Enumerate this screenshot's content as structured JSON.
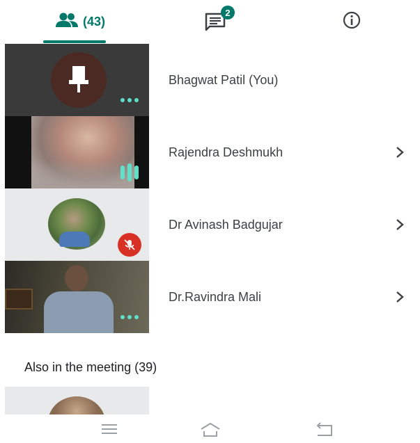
{
  "tabs": {
    "people_count": "(43)",
    "chat_badge": "2"
  },
  "participants": [
    {
      "name": "Bhagwat Patil (You)",
      "state": "muted-pin",
      "has_chevron": false
    },
    {
      "name": "Rajendra Deshmukh",
      "state": "speaking",
      "has_chevron": true
    },
    {
      "name": "Dr Avinash Badgujar",
      "state": "muted",
      "has_chevron": true
    },
    {
      "name": "Dr.Ravindra Mali",
      "state": "idle",
      "has_chevron": true
    }
  ],
  "also_in_meeting": "Also in the meeting (39)",
  "colors": {
    "accent": "#00796b",
    "audio_indicator": "#5fe0c8",
    "mute_red": "#d93025"
  },
  "icons": {
    "people_tab": "people-icon",
    "chat_tab": "chat-icon",
    "info_tab": "info-icon",
    "nav_menu": "menu-icon",
    "nav_home": "home-icon",
    "nav_back": "back-icon"
  }
}
